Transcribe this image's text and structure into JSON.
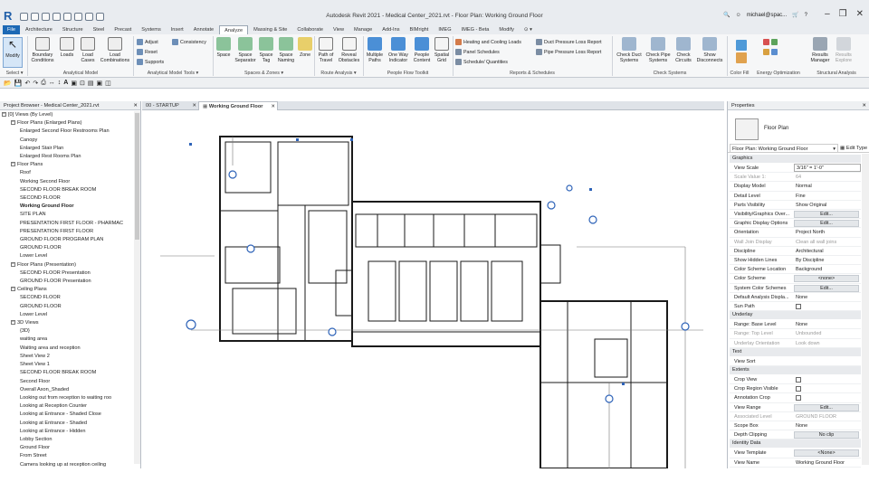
{
  "app": {
    "logo": "R",
    "window_title": "Autodesk Revit 2021 - Medical Center_2021.rvt - Floor Plan: Working Ground Floor",
    "user": "michael@spac...",
    "controls": [
      "–",
      "❒",
      "✕"
    ],
    "colors": {
      "file_tab": "#1d69b5",
      "accent": "#1f5ea8",
      "chrome": "#e9ecf0",
      "ribbon": "#f6f7f8",
      "drawing": "#1a1a1a",
      "tag": "#2e63b8"
    }
  },
  "ribbon_tabs": [
    "File",
    "Architecture",
    "Structure",
    "Steel",
    "Precast",
    "Systems",
    "Insert",
    "Annotate",
    "Analyze",
    "Massing & Site",
    "Collaborate",
    "View",
    "Manage",
    "Add-Ins",
    "BIMright",
    "IMEG",
    "IMEG - Beta",
    "Modify",
    "⊙ ▾"
  ],
  "active_tab": "Analyze",
  "ribbon": {
    "modify": "Modify",
    "select": "Select ▾",
    "boundary": "Boundary\nConditions",
    "loads": "Loads",
    "load_cases": "Load\nCases",
    "load_comb": "Load\nCombinations",
    "adjust": "Adjust",
    "reset": "Reset",
    "supports": "Supports",
    "consistency": "Consistency",
    "space": "Space",
    "space_sep": "Space\nSeparator",
    "space_tag": "Space\nTag",
    "space_naming": "Space\nNaming",
    "zone": "Zone",
    "path_travel": "Path of\nTravel",
    "reveal": "Reveal\nObstacles",
    "multiple_paths": "Multiple\nPaths",
    "one_way": "One Way\nIndicator",
    "people_content": "People\nContent",
    "spatial_grid": "Spatial\nGrid",
    "heating": "Heating and Cooling Loads",
    "panel_sched": "Panel  Schedules",
    "sched_qty": "Schedule/  Quantities",
    "duct_pressure": "Duct Pressure  Loss Report",
    "pipe_pressure": "Pipe Pressure  Loss Report",
    "check_duct": "Check Duct\nSystems",
    "check_pipe": "Check Pipe\nSystems",
    "check_circuits": "Check\nCircuits",
    "show_disc": "Show\nDisconnects",
    "results_mgr": "Results\nManager",
    "results_explore": "Results\nExplore",
    "panels": [
      "Analytical Model",
      "Analytical Model Tools ▾",
      "Spaces & Zones ▾",
      "Route Analysis ▾",
      "People Flow Toolkit",
      "Reports & Schedules",
      "Check Systems",
      "Color Fill",
      "Energy Optimization",
      "Structural Analysis"
    ]
  },
  "project_browser": {
    "title": "Project Browser - Medical Center_2021.rvt",
    "close": "✕",
    "items": [
      {
        "level": 0,
        "toggle": "−",
        "label": "[0] Views (By Level)"
      },
      {
        "level": 1,
        "toggle": "−",
        "label": "Floor Plans (Enlarged Plans)"
      },
      {
        "level": 2,
        "label": "Enlarged Second Floor Restrooms Plan"
      },
      {
        "level": 2,
        "label": "Canopy"
      },
      {
        "level": 2,
        "label": "Enlarged Stair Plan"
      },
      {
        "level": 2,
        "label": "Enlarged Rest Rooms Plan"
      },
      {
        "level": 1,
        "toggle": "−",
        "label": "Floor Plans"
      },
      {
        "level": 2,
        "label": "Roof"
      },
      {
        "level": 2,
        "label": "Working Second Floor"
      },
      {
        "level": 2,
        "label": "SECOND FLOOR BREAK ROOM"
      },
      {
        "level": 2,
        "label": "SECOND FLOOR"
      },
      {
        "level": 2,
        "label": "Working Ground Floor",
        "selected": true
      },
      {
        "level": 2,
        "label": "SITE PLAN"
      },
      {
        "level": 2,
        "label": "PRESENTATION FIRST FLOOR - PHARMAC"
      },
      {
        "level": 2,
        "label": "PRESENTATION FIRST FLOOR"
      },
      {
        "level": 2,
        "label": "GROUND FLOOR PROGRAM PLAN"
      },
      {
        "level": 2,
        "label": "GROUND FLOOR"
      },
      {
        "level": 2,
        "label": "Lower Level"
      },
      {
        "level": 1,
        "toggle": "−",
        "label": "Floor Plans (Presentation)"
      },
      {
        "level": 2,
        "label": "SECOND FLOOR Presentation"
      },
      {
        "level": 2,
        "label": "GROUND FLOOR Presentation"
      },
      {
        "level": 1,
        "toggle": "−",
        "label": "Ceiling Plans"
      },
      {
        "level": 2,
        "label": "SECOND FLOOR"
      },
      {
        "level": 2,
        "label": "GROUND FLOOR"
      },
      {
        "level": 2,
        "label": "Lower Level"
      },
      {
        "level": 1,
        "toggle": "−",
        "label": "3D Views"
      },
      {
        "level": 2,
        "label": "{3D}"
      },
      {
        "level": 2,
        "label": "waiting area"
      },
      {
        "level": 2,
        "label": "Waiting area and reception"
      },
      {
        "level": 2,
        "label": "Sheet View 2"
      },
      {
        "level": 2,
        "label": "Sheet View 1"
      },
      {
        "level": 2,
        "label": "SECOND FLOOR BREAK ROOM"
      },
      {
        "level": 2,
        "label": "Second Floor"
      },
      {
        "level": 2,
        "label": "Overall Axon_Shaded"
      },
      {
        "level": 2,
        "label": "Looking out from reception to waiting roo"
      },
      {
        "level": 2,
        "label": "Looking at Reception Counter"
      },
      {
        "level": 2,
        "label": "Looking at Entrance - Shaded Close"
      },
      {
        "level": 2,
        "label": "Looking at Entrance - Shaded"
      },
      {
        "level": 2,
        "label": "Looking at Entrance - Hidden"
      },
      {
        "level": 2,
        "label": "Lobby Section"
      },
      {
        "level": 2,
        "label": "Ground Floor"
      },
      {
        "level": 2,
        "label": "From Street"
      },
      {
        "level": 2,
        "label": "Camera looking up at reception ceiling"
      }
    ]
  },
  "view_tabs": [
    {
      "label": "00 - STARTUP",
      "active": false
    },
    {
      "label": "Working Ground Floor",
      "active": true
    }
  ],
  "properties": {
    "title": "Properties",
    "type_name": "Floor Plan",
    "instance": "Floor Plan: Working Ground Floor",
    "edit_type": "Edit Type",
    "sections": [
      {
        "name": "Graphics",
        "rows": [
          {
            "label": "View Scale",
            "value": "3/16\" = 1'-0\"",
            "kind": "input"
          },
          {
            "label": "Scale Value    1:",
            "value": "64",
            "gray": true
          },
          {
            "label": "Display Model",
            "value": "Normal"
          },
          {
            "label": "Detail Level",
            "value": "Fine"
          },
          {
            "label": "Parts Visibility",
            "value": "Show Original"
          },
          {
            "label": "Visibility/Graphics Over...",
            "value": "Edit...",
            "kind": "button"
          },
          {
            "label": "Graphic Display Options",
            "value": "Edit...",
            "kind": "button"
          },
          {
            "label": "Orientation",
            "value": "Project North"
          },
          {
            "label": "Wall Join Display",
            "value": "Clean all wall joins",
            "gray": true
          },
          {
            "label": "Discipline",
            "value": "Architectural"
          },
          {
            "label": "Show Hidden Lines",
            "value": "By Discipline"
          },
          {
            "label": "Color Scheme Location",
            "value": "Background"
          },
          {
            "label": "Color Scheme",
            "value": "<none>",
            "kind": "button"
          },
          {
            "label": "System Color Schemes",
            "value": "Edit...",
            "kind": "button"
          },
          {
            "label": "Default Analysis Displa...",
            "value": "None"
          },
          {
            "label": "Sun Path",
            "value": "",
            "kind": "check"
          }
        ]
      },
      {
        "name": "Underlay",
        "rows": [
          {
            "label": "Range: Base Level",
            "value": "None"
          },
          {
            "label": "Range: Top Level",
            "value": "Unbounded",
            "gray": true
          },
          {
            "label": "Underlay Orientation",
            "value": "Look down",
            "gray": true
          }
        ]
      },
      {
        "name": "Text",
        "rows": [
          {
            "label": "View Sort",
            "value": ""
          }
        ]
      },
      {
        "name": "Extents",
        "rows": [
          {
            "label": "Crop View",
            "value": "",
            "kind": "check"
          },
          {
            "label": "Crop Region Visible",
            "value": "",
            "kind": "check"
          },
          {
            "label": "Annotation Crop",
            "value": "",
            "kind": "check"
          },
          {
            "label": "View Range",
            "value": "Edit...",
            "kind": "button"
          },
          {
            "label": "Associated Level",
            "value": "GROUND FLOOR",
            "gray": true
          },
          {
            "label": "Scope Box",
            "value": "None"
          },
          {
            "label": "Depth Clipping",
            "value": "No clip",
            "kind": "button"
          }
        ]
      },
      {
        "name": "Identity Data",
        "rows": [
          {
            "label": "View Template",
            "value": "<None>",
            "kind": "button"
          },
          {
            "label": "View Name",
            "value": "Working Ground Floor"
          }
        ]
      }
    ]
  }
}
